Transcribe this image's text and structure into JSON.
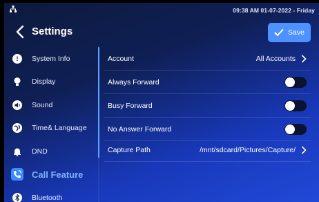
{
  "status_bar": {
    "network_icon": "network-icon",
    "datetime": "09:38 AM  01-07-2022 - Friday"
  },
  "header": {
    "title": "Settings",
    "back_icon": "chevron-left-icon",
    "save_label": "Save",
    "save_icon": "check-icon",
    "accent_color": "#4e92ff"
  },
  "sidebar": {
    "items": [
      {
        "label": "System Info",
        "icon": "info-icon",
        "active": false
      },
      {
        "label": "Display",
        "icon": "bulb-icon",
        "active": false
      },
      {
        "label": "Sound",
        "icon": "speaker-icon",
        "active": false
      },
      {
        "label": "Time& Language",
        "icon": "globe-icon",
        "active": false
      },
      {
        "label": "DND",
        "icon": "bell-icon",
        "active": false
      },
      {
        "label": "Call Feature",
        "icon": "phone-icon",
        "active": true
      },
      {
        "label": "Bluetooth",
        "icon": "bluetooth-icon",
        "active": false
      }
    ]
  },
  "settings": {
    "account": {
      "label": "Account",
      "value": "All Accounts"
    },
    "always_forward": {
      "label": "Always Forward",
      "enabled": false
    },
    "busy_forward": {
      "label": "Busy Forward",
      "enabled": false
    },
    "no_answer_forward": {
      "label": "No Answer Forward",
      "enabled": false
    },
    "capture_path": {
      "label": "Capture Path",
      "value": "/mnt/sdcard/Pictures/Capture/"
    }
  }
}
